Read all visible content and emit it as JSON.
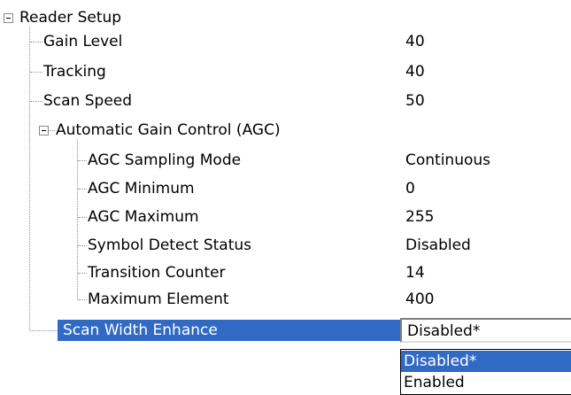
{
  "tree": {
    "root": {
      "label": "Reader Setup",
      "expanded": true
    },
    "items": [
      {
        "label": "Gain Level",
        "value": "40"
      },
      {
        "label": "Tracking",
        "value": "40"
      },
      {
        "label": "Scan Speed",
        "value": "50"
      }
    ],
    "agc": {
      "label": "Automatic Gain Control (AGC)",
      "expanded": true,
      "items": [
        {
          "label": "AGC Sampling Mode",
          "value": "Continuous"
        },
        {
          "label": "AGC Minimum",
          "value": "0"
        },
        {
          "label": "AGC Maximum",
          "value": "255"
        },
        {
          "label": "Symbol Detect Status",
          "value": "Disabled"
        },
        {
          "label": "Transition Counter",
          "value": "14"
        },
        {
          "label": "Maximum Element",
          "value": "400"
        }
      ]
    },
    "selected_item": {
      "label": "Scan Width Enhance",
      "value": "Disabled*",
      "options": [
        "Disabled*",
        "Enabled"
      ],
      "highlighted_option": "Disabled*"
    }
  },
  "colors": {
    "selection": "#316ac5",
    "selection_text": "#ffffff",
    "tree_lines": "#8e8e8e"
  }
}
